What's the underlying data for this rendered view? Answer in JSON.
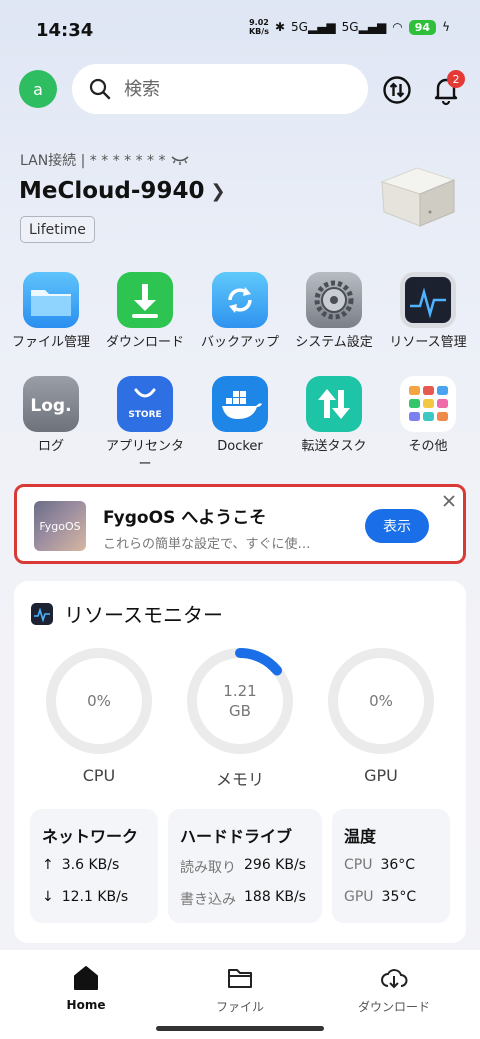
{
  "status_bar": {
    "time": "14:34",
    "net_speed_value": "9.02",
    "net_speed_unit": "KB/s",
    "signal_1": "5G",
    "signal_2": "5G",
    "battery": "94"
  },
  "header": {
    "avatar_letter": "a",
    "search_placeholder": "検索",
    "notification_count": "2"
  },
  "device": {
    "lan_label": "LAN接続 | * * * * * * *",
    "name": "MeCloud-9940",
    "plan": "Lifetime"
  },
  "apps": [
    {
      "label": "ファイル管理",
      "icon": "folder-icon"
    },
    {
      "label": "ダウンロード",
      "icon": "download-icon"
    },
    {
      "label": "バックアップ",
      "icon": "backup-icon"
    },
    {
      "label": "システム設定",
      "icon": "settings-gear-icon"
    },
    {
      "label": "リソース管理",
      "icon": "resource-monitor-icon"
    },
    {
      "label": "ログ",
      "icon": "log-icon",
      "icon_text": "Log."
    },
    {
      "label": "アプリセンター",
      "icon": "app-store-icon",
      "icon_text": "STORE"
    },
    {
      "label": "Docker",
      "icon": "docker-icon"
    },
    {
      "label": "転送タスク",
      "icon": "transfer-icon"
    },
    {
      "label": "その他",
      "icon": "more-apps-icon"
    }
  ],
  "welcome": {
    "thumb_text": "FygoOS",
    "title": "FygoOS へようこそ",
    "subtitle": "これらの簡単な設定で、すぐに使…",
    "button": "表示"
  },
  "resource_monitor": {
    "title": "リソースモニター",
    "gauges": [
      {
        "label": "CPU",
        "value": "0%",
        "fraction": 0
      },
      {
        "label": "メモリ",
        "value_line1": "1.21",
        "value_line2": "GB",
        "fraction": 0.14
      },
      {
        "label": "GPU",
        "value": "0%",
        "fraction": 0
      }
    ],
    "network": {
      "title": "ネットワーク",
      "up": "3.6 KB/s",
      "down": "12.1 KB/s"
    },
    "disk": {
      "title": "ハードドライブ",
      "read_label": "読み取り",
      "read_value": "296 KB/s",
      "write_label": "書き込み",
      "write_value": "188 KB/s"
    },
    "temp": {
      "title": "温度",
      "cpu_label": "CPU",
      "cpu_value": "36°C",
      "gpu_label": "GPU",
      "gpu_value": "35°C"
    }
  },
  "nav": [
    {
      "label": "Home",
      "icon": "home-icon",
      "active": true
    },
    {
      "label": "ファイル",
      "icon": "folder-outline-icon",
      "active": false
    },
    {
      "label": "ダウンロード",
      "icon": "cloud-download-icon",
      "active": false
    }
  ],
  "colors": {
    "accent": "#1a6fe8",
    "avatar": "#2fbd62",
    "highlight_border": "#d93a35",
    "badge": "#e53935"
  }
}
